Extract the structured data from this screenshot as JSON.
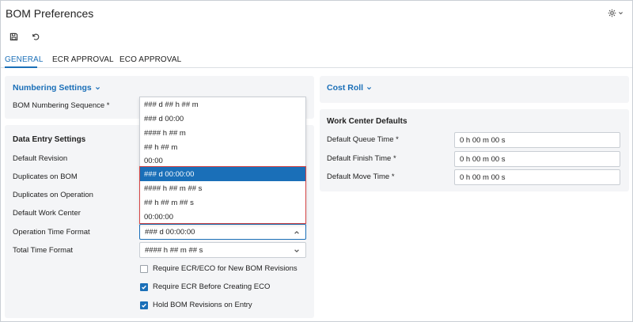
{
  "page": {
    "title": "BOM Preferences"
  },
  "toolbar": {
    "save": "save-icon",
    "undo": "undo-icon"
  },
  "tabs": [
    {
      "label": "GENERAL"
    },
    {
      "label": "ECR APPROVAL"
    },
    {
      "label": "ECO APPROVAL"
    }
  ],
  "numbering": {
    "title": "Numbering Settings",
    "sequence_label": "BOM Numbering Sequence *"
  },
  "data_entry": {
    "title": "Data Entry Settings",
    "default_revision": "Default Revision",
    "duplicates_bom": "Duplicates on BOM",
    "duplicates_operation": "Duplicates on Operation",
    "default_work_center": "Default Work Center",
    "operation_time_format_label": "Operation Time Format",
    "operation_time_format_value": "### d 00:00:00",
    "total_time_format_label": "Total Time Format",
    "total_time_format_value": "#### h ## m ## s",
    "checks": [
      {
        "label": "Require ECR/ECO for New BOM Revisions",
        "checked": false
      },
      {
        "label": "Require ECR Before Creating ECO",
        "checked": true
      },
      {
        "label": "Hold BOM Revisions on Entry",
        "checked": true
      }
    ]
  },
  "cost_roll": {
    "title": "Cost Roll"
  },
  "work_center": {
    "title": "Work Center Defaults",
    "fields": [
      {
        "label": "Default Queue Time *",
        "value": "0 h 00 m 00 s"
      },
      {
        "label": "Default Finish Time *",
        "value": "0 h 00 m 00 s"
      },
      {
        "label": "Default Move Time *",
        "value": "0 h 00 m 00 s"
      }
    ]
  },
  "dropdown": {
    "options": [
      "### d ## h ## m",
      "### d 00:00",
      "#### h ## m",
      "## h ## m",
      "00:00",
      "### d 00:00:00",
      "#### h ## m ## s",
      "## h ## m ## s",
      "00:00:00"
    ],
    "selected": "### d 00:00:00"
  },
  "colors": {
    "accent": "#1a6fb8",
    "highlight_border": "#d64545",
    "card_bg": "#f4f5f7"
  }
}
